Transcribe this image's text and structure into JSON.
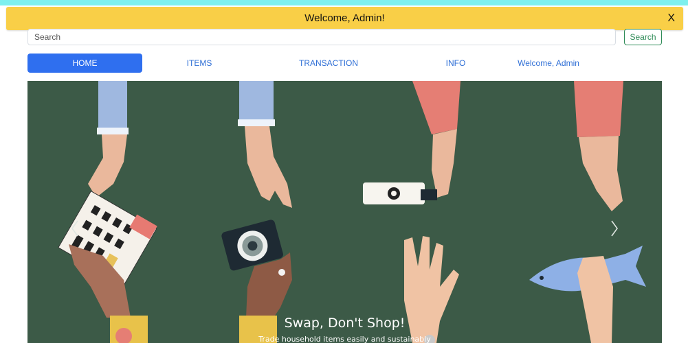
{
  "banner": {
    "message": "Welcome, Admin!",
    "close_label": "X"
  },
  "search": {
    "placeholder": "Search",
    "value": "",
    "button_label": "Search"
  },
  "nav": {
    "items": [
      {
        "label": "HOME",
        "active": true
      },
      {
        "label": "ITEMS"
      },
      {
        "label": "TRANSACTION"
      },
      {
        "label": "INFO"
      },
      {
        "label": "Welcome, Admin"
      }
    ]
  },
  "carousel": {
    "caption_title": "Swap, Don't Shop!",
    "caption_text": "Trade household items easily and sustainably",
    "prev_icon": "chevron-left-icon",
    "next_icon": "chevron-right-icon"
  },
  "colors": {
    "banner_bg": "#f9cf47",
    "top_strip": "#7ef0ee",
    "nav_active_bg": "#2f6fef",
    "nav_link": "#2f6fd6",
    "search_button": "#2e8b57",
    "carousel_bg": "#3c5a47"
  }
}
